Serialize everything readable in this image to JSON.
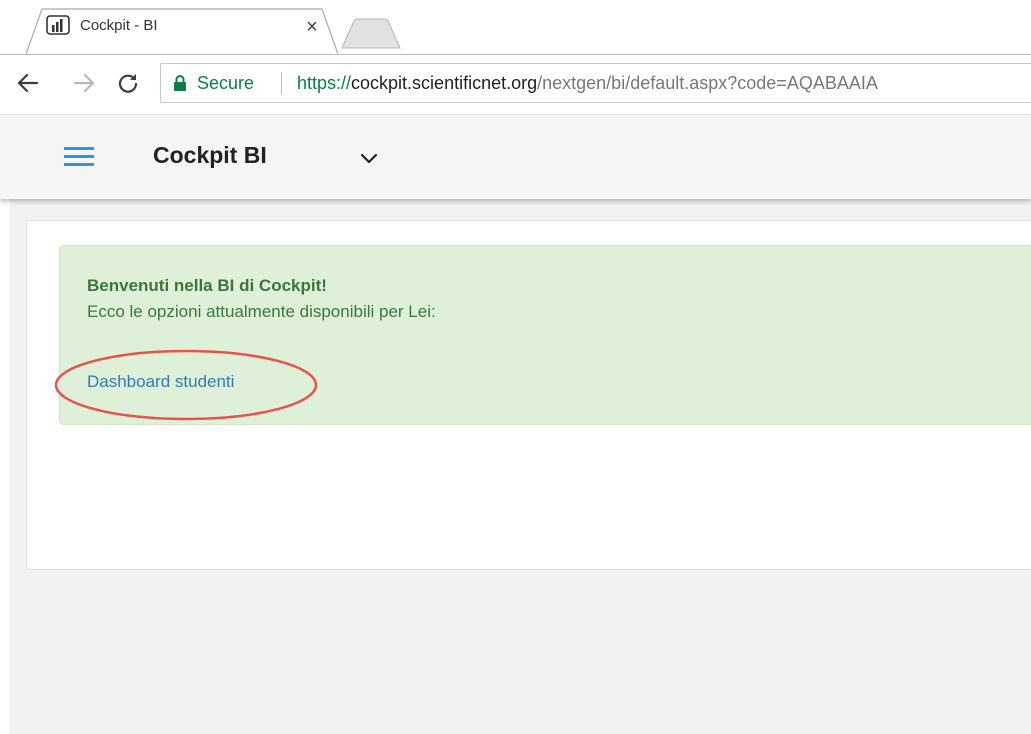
{
  "browser": {
    "tab": {
      "title": "Cockpit - BI",
      "close_glyph": "×",
      "favicon": "power-bi-icon"
    },
    "new_tab": "new-tab-button",
    "toolbar": {
      "back_icon": "back-arrow-icon",
      "forward_icon": "forward-arrow-icon",
      "reload_icon": "reload-icon"
    },
    "omnibox": {
      "lock_icon": "lock-icon",
      "secure_label": "Secure",
      "url_scheme": "https://",
      "url_host": "cockpit.scientificnet.org",
      "url_path": "/nextgen/bi/default.aspx?code=AQABAAIA"
    }
  },
  "app": {
    "menu_icon": "hamburger-menu-icon",
    "title": "Cockpit BI",
    "chevron_icon": "chevron-down-icon"
  },
  "welcome": {
    "title": "Benvenuti nella BI di Cockpit!",
    "body": "Ecco le opzioni attualmente disponibili per Lei:",
    "link": "Dashboard studenti"
  },
  "annotation": {
    "shape": "oval",
    "color": "#e8524a"
  },
  "colors": {
    "accent": "#2f96e6",
    "secure_green": "#0b8043",
    "alert_bg": "#dff0d8",
    "alert_text": "#3c763d",
    "link": "#337ab7"
  }
}
